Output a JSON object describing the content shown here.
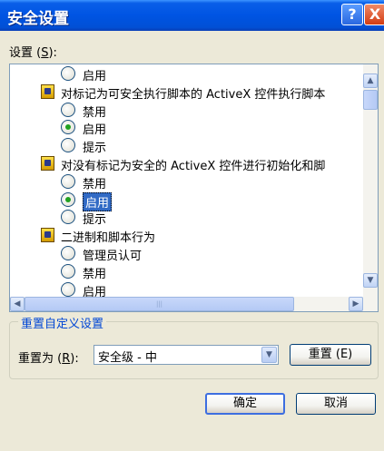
{
  "window": {
    "title": "安全设置"
  },
  "title_buttons": {
    "help": "?",
    "close": "X"
  },
  "settings_label": {
    "prefix": "设置 (",
    "key": "S",
    "suffix": "):"
  },
  "tree": [
    {
      "type": "option",
      "label": "启用",
      "checked": false
    },
    {
      "type": "category",
      "label": "对标记为可安全执行脚本的 ActiveX 控件执行脚本"
    },
    {
      "type": "option",
      "label": "禁用",
      "checked": false
    },
    {
      "type": "option",
      "label": "启用",
      "checked": true
    },
    {
      "type": "option",
      "label": "提示",
      "checked": false
    },
    {
      "type": "category",
      "label": "对没有标记为安全的 ActiveX 控件进行初始化和脚"
    },
    {
      "type": "option",
      "label": "禁用",
      "checked": false
    },
    {
      "type": "option",
      "label": "启用",
      "checked": true,
      "selected": true
    },
    {
      "type": "option",
      "label": "提示",
      "checked": false
    },
    {
      "type": "category",
      "label": "二进制和脚本行为"
    },
    {
      "type": "option",
      "label": "管理员认可",
      "checked": false
    },
    {
      "type": "option",
      "label": "禁用",
      "checked": false
    },
    {
      "type": "option",
      "label": "启用",
      "checked": false
    }
  ],
  "reset_group": {
    "legend": "重置自定义设置",
    "label_prefix": "重置为 (",
    "label_key": "R",
    "label_suffix": "):",
    "combo_value": "安全级 - 中",
    "reset_button": "重置 (E)"
  },
  "buttons": {
    "ok": "确定",
    "cancel": "取消"
  },
  "icons": {
    "category": "security-setting-icon",
    "scroll_up": "arrow-up-icon",
    "scroll_down": "arrow-down-icon",
    "scroll_left": "arrow-left-icon",
    "scroll_right": "arrow-right-icon"
  }
}
